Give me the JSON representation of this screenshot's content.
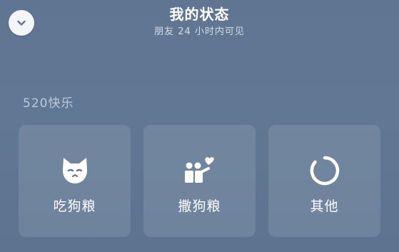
{
  "header": {
    "title": "我的状态",
    "subtitle": "朋友 24 小时内可见",
    "collapse_icon": "chevron-down-icon"
  },
  "section": {
    "label": "520快乐"
  },
  "cards": [
    {
      "label": "吃狗粮",
      "icon": "cat-face-icon"
    },
    {
      "label": "撒狗粮",
      "icon": "couple-heart-icon"
    },
    {
      "label": "其他",
      "icon": "loading-ring-icon"
    }
  ],
  "colors": {
    "background": "#5f7592",
    "card": "rgba(255,255,255,0.11)",
    "text": "#ffffff"
  }
}
